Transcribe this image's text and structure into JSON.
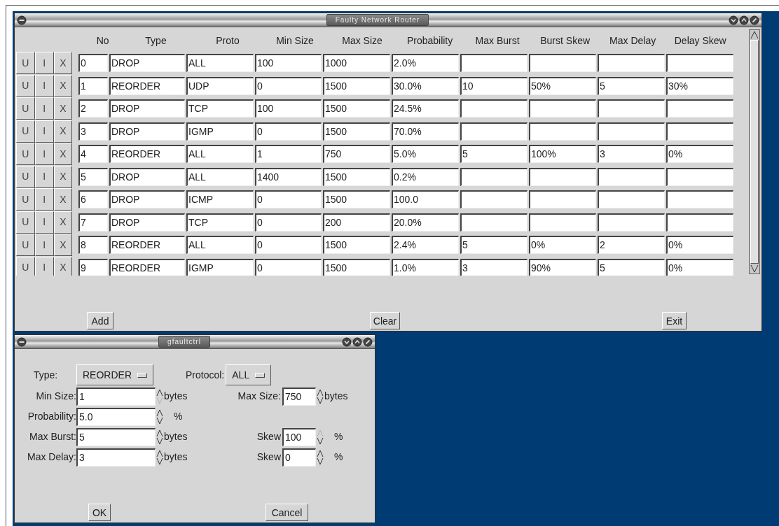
{
  "main_window": {
    "title": "Faulty Network Router",
    "columns": [
      "No",
      "Type",
      "Proto",
      "Min Size",
      "Max Size",
      "Probability",
      "Max Burst",
      "Burst Skew",
      "Max Delay",
      "Delay Skew"
    ],
    "rows": [
      {
        "buttons": [
          "U",
          "I",
          "X"
        ],
        "cells": [
          "0",
          "DROP",
          "ALL",
          "100",
          "1000",
          "2.0%",
          "",
          "",
          "",
          ""
        ]
      },
      {
        "buttons": [
          "U",
          "I",
          "X"
        ],
        "cells": [
          "1",
          "REORDER",
          "UDP",
          "0",
          "1500",
          "30.0%",
          "10",
          "50%",
          "5",
          "30%"
        ]
      },
      {
        "buttons": [
          "U",
          "I",
          "X"
        ],
        "cells": [
          "2",
          "DROP",
          "TCP",
          "100",
          "1500",
          "24.5%",
          "",
          "",
          "",
          ""
        ]
      },
      {
        "buttons": [
          "U",
          "I",
          "X"
        ],
        "cells": [
          "3",
          "DROP",
          "IGMP",
          "0",
          "1500",
          "70.0%",
          "",
          "",
          "",
          ""
        ]
      },
      {
        "buttons": [
          "U",
          "I",
          "X"
        ],
        "cells": [
          "4",
          "REORDER",
          "ALL",
          "1",
          "750",
          "5.0%",
          "5",
          "100%",
          "3",
          "0%"
        ]
      },
      {
        "buttons": [
          "U",
          "I",
          "X"
        ],
        "cells": [
          "5",
          "DROP",
          "ALL",
          "1400",
          "1500",
          "0.2%",
          "",
          "",
          "",
          ""
        ]
      },
      {
        "buttons": [
          "U",
          "I",
          "X"
        ],
        "cells": [
          "6",
          "DROP",
          "ICMP",
          "0",
          "1500",
          "100.0",
          "",
          "",
          "",
          ""
        ]
      },
      {
        "buttons": [
          "U",
          "I",
          "X"
        ],
        "cells": [
          "7",
          "DROP",
          "TCP",
          "0",
          "200",
          "20.0%",
          "",
          "",
          "",
          ""
        ]
      },
      {
        "buttons": [
          "U",
          "I",
          "X"
        ],
        "cells": [
          "8",
          "REORDER",
          "ALL",
          "0",
          "1500",
          "2.4%",
          "5",
          "0%",
          "2",
          "0%"
        ]
      },
      {
        "buttons": [
          "U",
          "I",
          "X"
        ],
        "cells": [
          "9",
          "REORDER",
          "IGMP",
          "0",
          "1500",
          "1.0%",
          "3",
          "90%",
          "5",
          "0%"
        ]
      }
    ],
    "buttons": [
      "Add",
      "Clear",
      "Exit"
    ]
  },
  "dialog": {
    "title": "gfaultctrl",
    "type": {
      "label": "Type:",
      "value": "REORDER"
    },
    "protocol": {
      "label": "Protocol:",
      "value": "ALL"
    },
    "rows": [
      {
        "left": {
          "label": "Min Size:",
          "value": "1",
          "unit": "bytes",
          "up_disabled": false,
          "down_disabled": true
        },
        "right": {
          "label": "Max Size:",
          "value": "750",
          "unit": "bytes",
          "up_disabled": false,
          "down_disabled": false
        }
      },
      {
        "left": {
          "label": "Probability:",
          "value": "5.0",
          "unit": "%",
          "up_disabled": false,
          "down_disabled": false
        }
      },
      {
        "left": {
          "label": "Max Burst:",
          "value": "5",
          "unit": "bytes",
          "up_disabled": false,
          "down_disabled": false
        },
        "right": {
          "label": "Skew",
          "value": "100",
          "unit": "%",
          "up_disabled": true,
          "down_disabled": false
        }
      },
      {
        "left": {
          "label": "Max Delay:",
          "value": "3",
          "unit": "bytes",
          "up_disabled": false,
          "down_disabled": false
        },
        "right": {
          "label": "Skew",
          "value": "0",
          "unit": "%",
          "up_disabled": false,
          "down_disabled": false
        }
      }
    ],
    "buttons": [
      "OK",
      "Cancel"
    ]
  }
}
